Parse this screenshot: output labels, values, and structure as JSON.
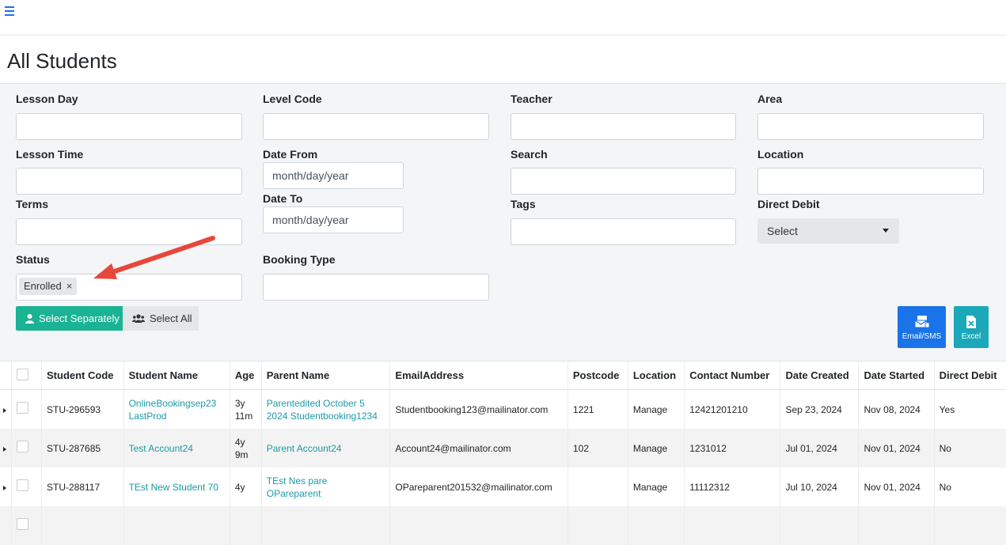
{
  "page": {
    "title": "All Students"
  },
  "filters": {
    "lesson_day": {
      "label": "Lesson Day",
      "value": ""
    },
    "level_code": {
      "label": "Level Code",
      "value": ""
    },
    "teacher": {
      "label": "Teacher",
      "value": ""
    },
    "area": {
      "label": "Area",
      "value": ""
    },
    "lesson_time": {
      "label": "Lesson Time",
      "value": ""
    },
    "date_from": {
      "label": "Date From",
      "placeholder": "month/day/year"
    },
    "search": {
      "label": "Search",
      "value": ""
    },
    "location": {
      "label": "Location",
      "value": ""
    },
    "terms": {
      "label": "Terms",
      "value": ""
    },
    "date_to": {
      "label": "Date To",
      "placeholder": "month/day/year"
    },
    "tags": {
      "label": "Tags",
      "value": ""
    },
    "direct_debit": {
      "label": "Direct Debit",
      "selected": "Select"
    },
    "status": {
      "label": "Status",
      "tag": "Enrolled",
      "remove": "×"
    },
    "booking_type": {
      "label": "Booking Type",
      "value": ""
    }
  },
  "actions": {
    "select_separately": "Select Separately",
    "select_all": "Select All",
    "email_sms": "Email/SMS",
    "excel": "Excel"
  },
  "table": {
    "headers": [
      "Student Code",
      "Student Name",
      "Age",
      "Parent Name",
      "EmailAddress",
      "Postcode",
      "Location",
      "Contact Number",
      "Date Created",
      "Date Started",
      "Direct Debit"
    ],
    "rows": [
      {
        "code": "STU-296593",
        "name_line1": "OnlineBookingsep23",
        "name_line2": "LastProd",
        "age_line1": "3y",
        "age_line2": "11m",
        "parent_line1": "Parentedited October 5",
        "parent_line2": "2024 Studentbooking1234",
        "email": "Studentbooking123@mailinator.com",
        "postcode": "1221",
        "location": "Manage",
        "contact": "12421201210",
        "created": "Sep 23, 2024",
        "started": "Nov 08, 2024",
        "dd": "Yes"
      },
      {
        "code": "STU-287685",
        "name_line1": "Test Account24",
        "name_line2": "",
        "age_line1": "4y",
        "age_line2": "9m",
        "parent_line1": "Parent Account24",
        "parent_line2": "",
        "email": "Account24@mailinator.com",
        "postcode": "102",
        "location": "Manage",
        "contact": "1231012",
        "created": "Jul 01, 2024",
        "started": "Nov 01, 2024",
        "dd": "No"
      },
      {
        "code": "STU-288117",
        "name_line1": "TEst New Student 70",
        "name_line2": "",
        "age_line1": "4y",
        "age_line2": "",
        "parent_line1": "TEst Nes pare",
        "parent_line2": "OPareparent",
        "email": "OPareparent201532@mailinator.com",
        "postcode": "",
        "location": "Manage",
        "contact": "11112312",
        "created": "Jul 10, 2024",
        "started": "Nov 01, 2024",
        "dd": "No"
      }
    ]
  },
  "colors": {
    "accent_green": "#1ab394",
    "accent_blue": "#1a73e8",
    "accent_teal": "#1ba8b8",
    "link": "#1b9aa9",
    "arrow": "#e8473b"
  },
  "icons": [
    "menu-icon",
    "user-icon",
    "users-icon",
    "email-sms-icon",
    "excel-icon",
    "remove-icon",
    "chevron-down-icon",
    "expand-row-icon",
    "annotation-arrow"
  ]
}
